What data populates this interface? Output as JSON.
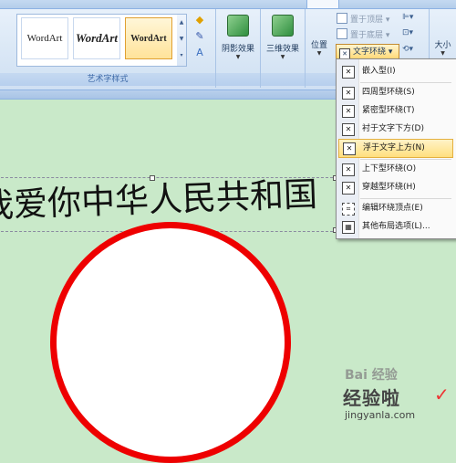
{
  "ribbon": {
    "wordart_styles": {
      "group_label": "艺术字样式",
      "items": [
        "WordArt",
        "WordArt",
        "WordArt"
      ]
    },
    "shadow_effects": {
      "label": "阴影效果"
    },
    "3d_effects": {
      "label": "三维效果"
    },
    "arrange": {
      "position_label": "位置",
      "bring_to_front": "置于顶层",
      "send_to_back": "置于底层",
      "text_wrapping": "文字环绕",
      "size_label": "大小"
    }
  },
  "document": {
    "wordart_text": "我爱你中华人民共和国"
  },
  "wrap_menu": {
    "items": [
      {
        "label": "嵌入型(I)",
        "highlighted": false
      },
      {
        "label": "四周型环绕(S)",
        "highlighted": false
      },
      {
        "label": "紧密型环绕(T)",
        "highlighted": false
      },
      {
        "label": "衬于文字下方(D)",
        "highlighted": false
      },
      {
        "label": "浮于文字上方(N)",
        "highlighted": true
      },
      {
        "label": "上下型环绕(O)",
        "highlighted": false
      },
      {
        "label": "穿越型环绕(H)",
        "highlighted": false
      },
      {
        "label": "编辑环绕顶点(E)",
        "highlighted": false
      },
      {
        "label": "其他布局选项(L)...",
        "highlighted": false
      }
    ]
  },
  "watermark": {
    "logo": "Bai 经验",
    "brand": "经验啦",
    "url": "jingyanla.com",
    "mark": "✓"
  },
  "colors": {
    "document_background": "#c9e9c9",
    "circle_stroke": "#ee0000",
    "menu_highlight": "#ffdf7e"
  }
}
